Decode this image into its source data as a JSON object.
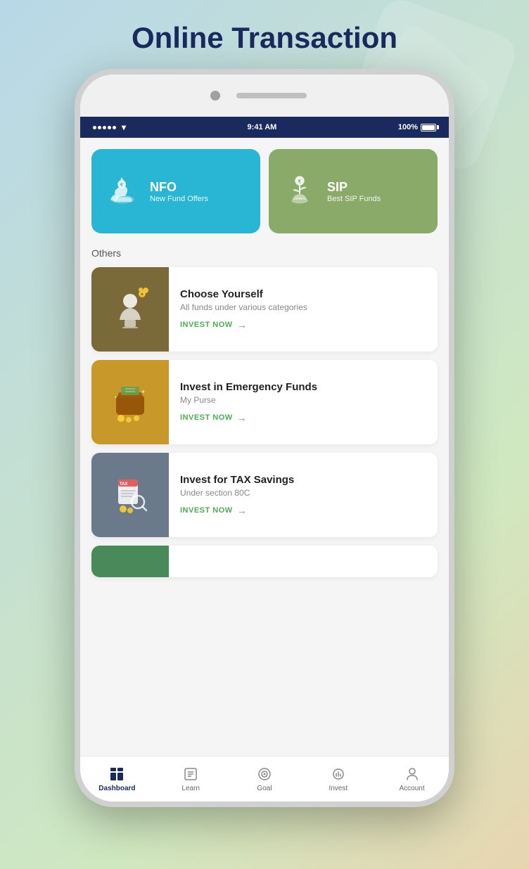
{
  "page": {
    "title": "Online Transaction"
  },
  "status_bar": {
    "time": "9:41 AM",
    "battery": "100%"
  },
  "top_cards": [
    {
      "id": "nfo",
      "title": "NFO",
      "subtitle": "New Fund Offers",
      "color": "#29b6d4",
      "icon": "nfo-icon"
    },
    {
      "id": "sip",
      "title": "SIP",
      "subtitle": "Best SIP Funds",
      "color": "#8aaa6a",
      "icon": "sip-icon"
    }
  ],
  "others_label": "Others",
  "list_items": [
    {
      "id": "choose-yourself",
      "title": "Choose Yourself",
      "subtitle": "All funds under various categories",
      "cta": "INVEST NOW",
      "bg_color": "#7a6a3a",
      "icon": "choose-icon"
    },
    {
      "id": "emergency-funds",
      "title": "Invest in Emergency Funds",
      "subtitle": "My Purse",
      "cta": "INVEST NOW",
      "bg_color": "#c9982a",
      "icon": "emergency-icon"
    },
    {
      "id": "tax-savings",
      "title": "Invest for TAX Savings",
      "subtitle": "Under section 80C",
      "cta": "INVEST NOW",
      "bg_color": "#6a7a8a",
      "icon": "tax-icon"
    }
  ],
  "bottom_nav": [
    {
      "id": "dashboard",
      "label": "Dashboard",
      "icon": "dashboard-icon",
      "active": true
    },
    {
      "id": "learn",
      "label": "Learn",
      "icon": "learn-icon",
      "active": false
    },
    {
      "id": "goal",
      "label": "Goal",
      "icon": "goal-icon",
      "active": false
    },
    {
      "id": "invest",
      "label": "Invest",
      "icon": "invest-icon",
      "active": false
    },
    {
      "id": "account",
      "label": "Account",
      "icon": "account-icon",
      "active": false
    }
  ]
}
